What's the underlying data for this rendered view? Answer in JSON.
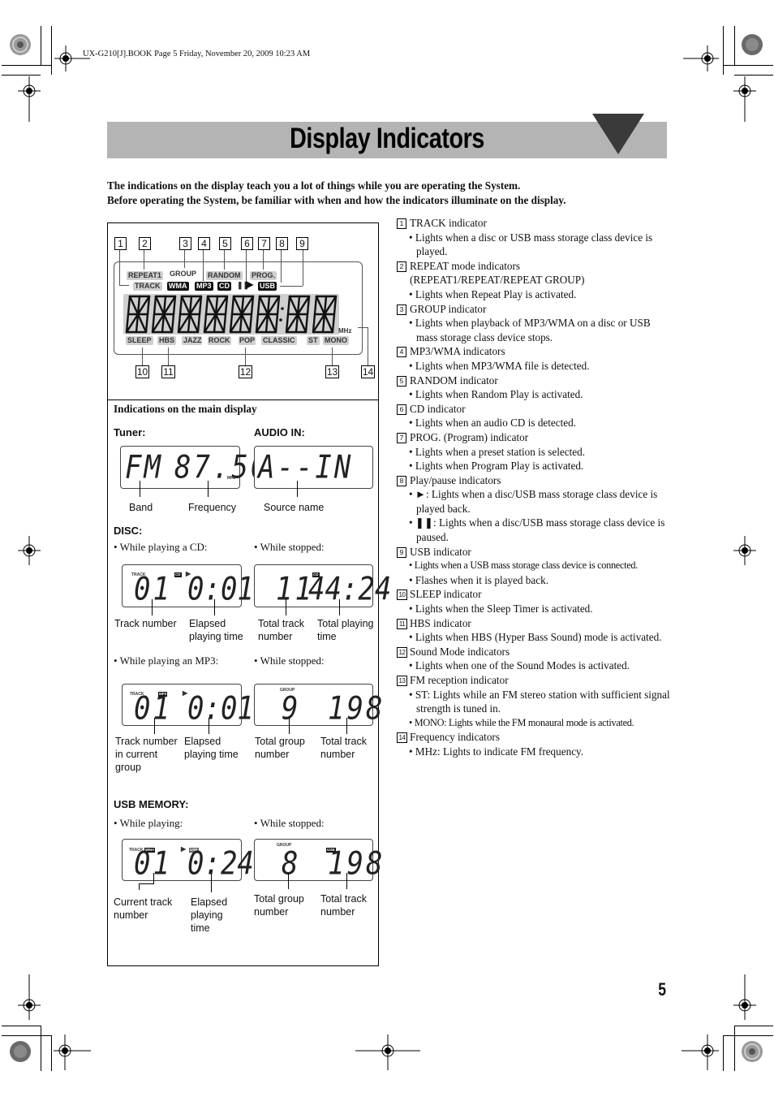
{
  "print_header": "UX-G210[J].BOOK  Page 5  Friday, November 20, 2009  10:23 AM",
  "title": "Display Indicators",
  "intro": [
    "The indications on the display teach you a lot of things while you are operating the System.",
    "Before operating the System, be familiar with when and how the indicators illuminate on the display."
  ],
  "diagram": {
    "callouts_top": [
      "1",
      "2",
      "3",
      "4",
      "5",
      "6",
      "7",
      "8",
      "9"
    ],
    "callouts_bottom": [
      "10",
      "11",
      "12",
      "13",
      "14"
    ],
    "indicators_row1": [
      "REPEAT1",
      "GROUP",
      "RANDOM",
      "PROG."
    ],
    "indicators_row2": {
      "track": "TRACK",
      "wma": "WMA",
      "mp3": "MP3",
      "cd": "CD",
      "pause": "❚❚",
      "play": "▶",
      "usb": "USB"
    },
    "bottom_row": [
      "SLEEP",
      "HBS",
      "JAZZ",
      "ROCK",
      "POP",
      "CLASSIC",
      "ST",
      "MONO"
    ],
    "mhz": "MHz"
  },
  "main_display": {
    "heading": "Indications on the main display",
    "tuner": {
      "label": "Tuner:",
      "display_band": "FM",
      "display_freq": "87.50",
      "unit": "MHz",
      "captions": [
        "Band",
        "Frequency"
      ]
    },
    "audio_in": {
      "label": "AUDIO IN:",
      "display": "A--IN",
      "captions": [
        "Source name"
      ]
    },
    "disc": {
      "label": "DISC:",
      "cd_playing": {
        "label": "• While playing a CD:",
        "track_label": "TRACK",
        "badge": "CD",
        "play": "▶",
        "track": "01",
        "time": "0:01",
        "captions": [
          "Track number",
          "Elapsed\nplaying time"
        ]
      },
      "cd_stopped": {
        "label": "• While stopped:",
        "badge": "CD",
        "tracks": "11",
        "time": "44:24",
        "captions": [
          "Total track\nnumber",
          "Total playing\ntime"
        ]
      },
      "mp3_playing": {
        "label": "• While playing an MP3:",
        "track_label": "TRACK",
        "badge": "MP3",
        "play": "▶",
        "track": "01",
        "time": "0:01",
        "captions": [
          "Track number\nin current\ngroup",
          "Elapsed\nplaying time"
        ]
      },
      "mp3_stopped": {
        "label": "• While stopped:",
        "group_label": "GROUP",
        "groups": "9",
        "tracks": "198",
        "captions": [
          "Total group\nnumber",
          "Total track\nnumber"
        ]
      }
    },
    "usb": {
      "label": "USB MEMORY:",
      "playing": {
        "label": "• While playing:",
        "track_label": "TRACK",
        "badge": "WMA",
        "play": "▶",
        "usb_badge": "USB",
        "track": "01",
        "time": "0:24",
        "captions": [
          "Current track\nnumber",
          "Elapsed\nplaying\ntime"
        ]
      },
      "stopped": {
        "label": "• While stopped:",
        "group_label": "GROUP",
        "badge": "USB",
        "groups": "8",
        "tracks": "198",
        "captions": [
          "Total group\nnumber",
          "Total track\nnumber"
        ]
      }
    }
  },
  "legend": [
    {
      "num": "1",
      "title": "TRACK indicator",
      "bullets": [
        "• Lights when a disc or USB mass storage class device is played."
      ]
    },
    {
      "num": "2",
      "title": "REPEAT mode indicators",
      "subtitle": "(REPEAT1/REPEAT/REPEAT GROUP)",
      "bullets": [
        "• Lights when Repeat Play is activated."
      ]
    },
    {
      "num": "3",
      "title": "GROUP indicator",
      "bullets": [
        "• Lights when playback of MP3/WMA on a disc or USB mass storage class device stops."
      ]
    },
    {
      "num": "4",
      "title": "MP3/WMA indicators",
      "bullets": [
        "• Lights when MP3/WMA file is detected."
      ]
    },
    {
      "num": "5",
      "title": "RANDOM indicator",
      "bullets": [
        "• Lights when Random Play is activated."
      ]
    },
    {
      "num": "6",
      "title": "CD indicator",
      "bullets": [
        "• Lights when an audio CD is detected."
      ]
    },
    {
      "num": "7",
      "title": "PROG. (Program) indicator",
      "bullets": [
        "• Lights when a preset station is selected.",
        "• Lights when Program Play is activated."
      ]
    },
    {
      "num": "8",
      "title": "Play/pause indicators",
      "bullets": [
        "• ►: Lights when a disc/USB mass storage class device is played back.",
        "• ❚❚: Lights when a disc/USB mass storage class device is paused."
      ]
    },
    {
      "num": "9",
      "title": "USB indicator",
      "bullets": [
        "• Lights when a USB mass storage class device is connected.",
        "• Flashes when it is played back."
      ]
    },
    {
      "num": "10",
      "title": "SLEEP indicator",
      "bullets": [
        "• Lights when the Sleep Timer is activated."
      ]
    },
    {
      "num": "11",
      "title": "HBS indicator",
      "bullets": [
        "• Lights when HBS (Hyper Bass Sound) mode is activated."
      ]
    },
    {
      "num": "12",
      "title": "Sound Mode indicators",
      "bullets": [
        "• Lights when one of the Sound Modes is activated."
      ]
    },
    {
      "num": "13",
      "title": "FM reception indicator",
      "bullets": [
        "• ST: Lights while an FM stereo station with sufficient signal strength is tuned in.",
        "• MONO: Lights while the FM monaural mode is activated."
      ]
    },
    {
      "num": "14",
      "title": "Frequency indicators",
      "bullets": [
        "• MHz: Lights to indicate FM frequency."
      ]
    }
  ],
  "page_number": "5"
}
